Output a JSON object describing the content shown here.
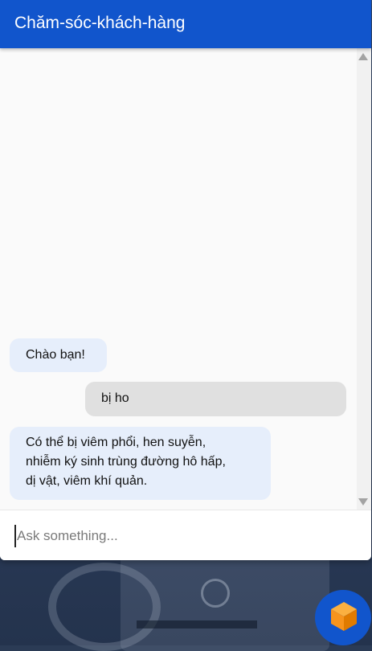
{
  "header": {
    "title": "Chăm-sóc-khách-hàng"
  },
  "messages": [
    {
      "role": "bot",
      "text": "Chào bạn!"
    },
    {
      "role": "user",
      "text": "bị ho"
    },
    {
      "role": "bot",
      "lines": [
        "Có thể bị viêm phổi, hen suyễn,",
        "nhiễm ký sinh trùng đường hô hấp,",
        "dị vật, viêm khí quản."
      ]
    }
  ],
  "input": {
    "placeholder": "Ask something...",
    "value": ""
  },
  "icons": {
    "launcher": "cube-icon",
    "scroll_up": "scroll-up-arrow-icon",
    "scroll_down": "scroll-down-arrow-icon"
  },
  "colors": {
    "header_bg": "#1155cc",
    "bot_bubble": "#e6eefb",
    "user_bubble": "#e0e0e0",
    "launcher_bg": "#1155cc",
    "cube_orange": "#f7941d"
  }
}
